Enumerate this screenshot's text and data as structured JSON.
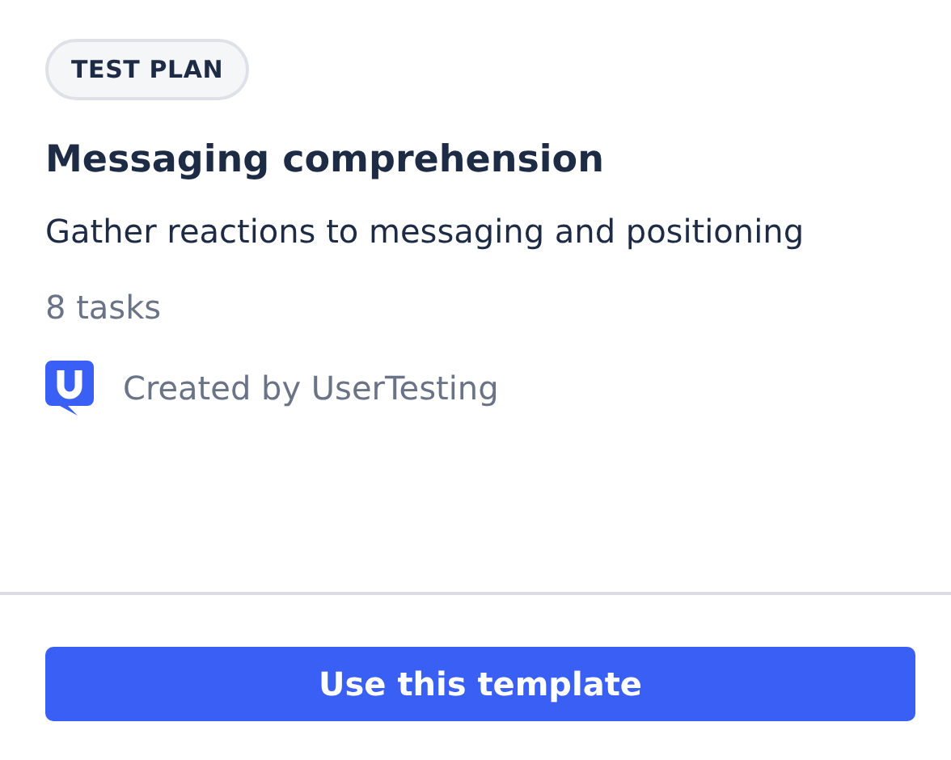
{
  "badge": "TEST PLAN",
  "title": "Messaging comprehension",
  "description": "Gather reactions to messaging and positioning",
  "task_count": "8 tasks",
  "creator": "Created by UserTesting",
  "button": "Use this template"
}
